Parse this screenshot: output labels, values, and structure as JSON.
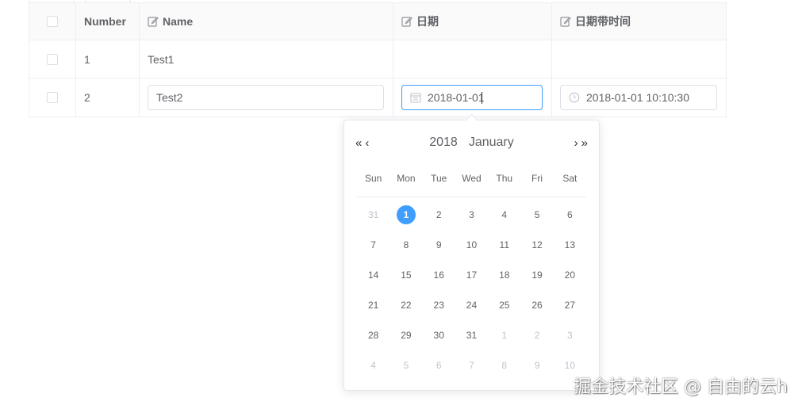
{
  "table": {
    "columns": {
      "number": "Number",
      "name": "Name",
      "date": "日期",
      "datetime": "日期带时间"
    },
    "rows": [
      {
        "number": "1",
        "name": "Test1",
        "date": "",
        "datetime": ""
      },
      {
        "number": "2",
        "name": "Test2",
        "date": "2018-01-01",
        "datetime": "2018-01-01 10:10:30"
      }
    ]
  },
  "picker": {
    "year": "2018",
    "month": "January",
    "nav": {
      "prev_year": "«",
      "prev_month": "‹",
      "next_month": "›",
      "next_year": "»"
    },
    "weekdays": [
      "Sun",
      "Mon",
      "Tue",
      "Wed",
      "Thu",
      "Fri",
      "Sat"
    ],
    "weeks": [
      [
        "31",
        "1",
        "2",
        "3",
        "4",
        "5",
        "6"
      ],
      [
        "7",
        "8",
        "9",
        "10",
        "11",
        "12",
        "13"
      ],
      [
        "14",
        "15",
        "16",
        "17",
        "18",
        "19",
        "20"
      ],
      [
        "21",
        "22",
        "23",
        "24",
        "25",
        "26",
        "27"
      ],
      [
        "28",
        "29",
        "30",
        "31",
        "1",
        "2",
        "3"
      ],
      [
        "4",
        "5",
        "6",
        "7",
        "8",
        "9",
        "10"
      ]
    ]
  },
  "watermark": "掘金技术社区 @ 自由的云h",
  "colors": {
    "accent": "#409eff",
    "border": "#ebeef5",
    "text": "#606266",
    "muted": "#c0c4cc"
  }
}
